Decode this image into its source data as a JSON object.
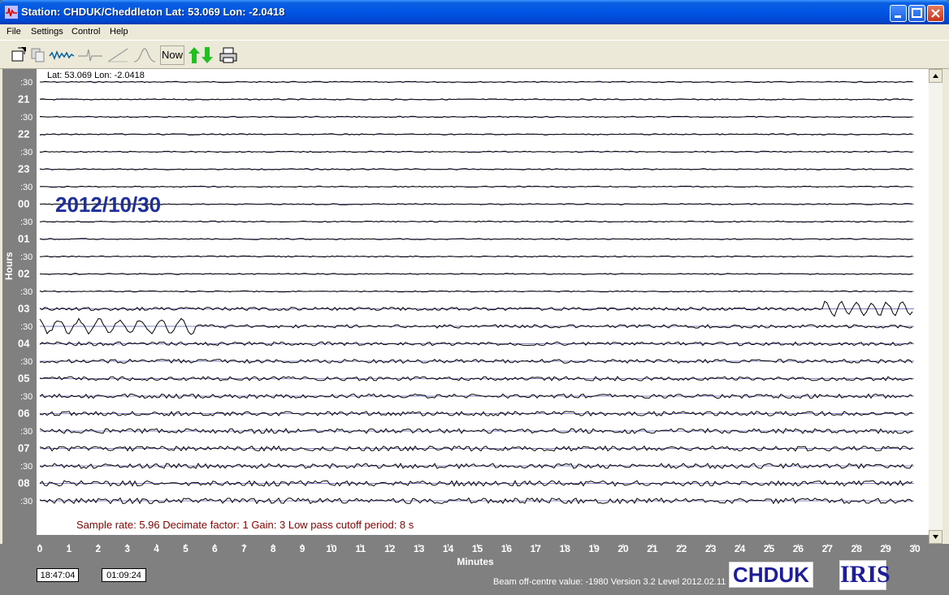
{
  "window": {
    "title": "Station: CHDUK/Cheddleton Lat: 53.069 Lon: -2.0418",
    "icon": "seismograph-app-icon"
  },
  "menu": [
    "File",
    "Settings",
    "Control",
    "Help"
  ],
  "toolbar": {
    "now_label": "Now",
    "icons": [
      "open-file-icon",
      "copy-icon",
      "waveform-icon",
      "filter-icon",
      "slope-icon",
      "pulse-icon",
      "up-down-arrows-icon",
      "print-icon"
    ]
  },
  "plot": {
    "coords_text": "Lat: 53.069 Lon: -2.0418",
    "date_label": "2012/10/30",
    "info_text": "Sample rate: 5.96  Decimate factor: 1  Gain: 3  Low pass cutoff period: 8 s",
    "row_labels": [
      ":30",
      "21",
      ":30",
      "22",
      ":30",
      "23",
      ":30",
      "00",
      ":30",
      "01",
      ":30",
      "02",
      ":30",
      "03",
      ":30",
      "04",
      ":30",
      "05",
      ":30",
      "06",
      ":30",
      "07",
      ":30",
      "08",
      ":30"
    ],
    "x_ticks": [
      "0",
      "1",
      "2",
      "3",
      "4",
      "5",
      "6",
      "7",
      "8",
      "9",
      "10",
      "11",
      "12",
      "13",
      "14",
      "15",
      "16",
      "17",
      "18",
      "19",
      "20",
      "21",
      "22",
      "23",
      "24",
      "25",
      "26",
      "27",
      "28",
      "29",
      "30"
    ],
    "x_label": "Minutes",
    "y_label": "Hours"
  },
  "status": {
    "time1": "18:47:04",
    "time2": "01:09:24",
    "beam_text": "Beam off-centre value: -1980  Version 3.2 Level 2012.02.11",
    "station_logo": "CHDUK",
    "iris_logo": "IRIS"
  },
  "colors": {
    "trace": "#000000",
    "baseline": "#000080",
    "date_label": "#1e2f9c",
    "info_text": "#8b0000",
    "axis_bg": "#808080"
  }
}
